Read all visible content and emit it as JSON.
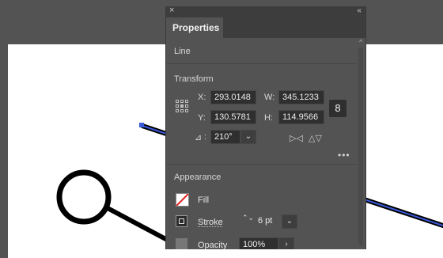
{
  "panel": {
    "close_glyph": "×",
    "collapse_glyph": "‹‹",
    "tab": "Properties",
    "selection_type": "Line",
    "scroll_up_glyph": "^"
  },
  "transform": {
    "heading": "Transform",
    "x_label": "X:",
    "x_value": "293.0148",
    "y_label": "Y:",
    "y_value": "130.5781",
    "w_label": "W:",
    "w_value": "345.1233",
    "h_label": "H:",
    "h_value": "114.9566",
    "angle_icon_glyph": "⊿",
    "angle_colon": ":",
    "angle_value": "210°",
    "chevron_glyph": "⌄",
    "link_glyph": "8",
    "flip_h_glyph": "▷◁",
    "flip_v_glyph": "△▽",
    "more_glyph": "•••"
  },
  "appearance": {
    "heading": "Appearance",
    "fill_label": "Fill",
    "stroke_label": "Stroke",
    "stroke_stepper_glyph": "⌃⌄",
    "stroke_value": "6 pt",
    "stroke_chevron": "⌄",
    "opacity_label": "Opacity",
    "opacity_value": "100%",
    "opacity_arrow": "›"
  },
  "colors": {
    "panel_bg": "#535353",
    "field_bg": "#2f2f2f",
    "selection_blue": "#3b5bdb",
    "fill_none_red": "#e02020"
  }
}
